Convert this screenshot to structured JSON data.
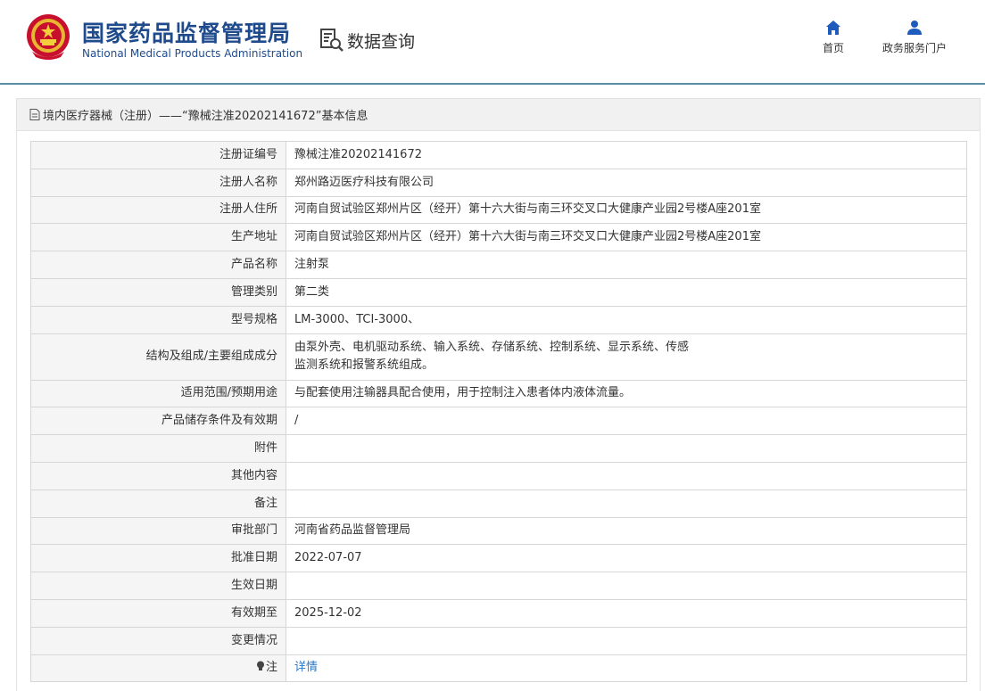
{
  "header": {
    "logo_cn": "国家药品监督管理局",
    "logo_en": "National Medical Products Administration",
    "query_label": "数据查询",
    "nav": [
      {
        "label": "首页",
        "icon": "home-icon"
      },
      {
        "label": "政务服务门户",
        "icon": "user-icon"
      }
    ],
    "accent_color": "#1f4a8c"
  },
  "panel": {
    "title": "境内医疗器械（注册）——“豫械注准20202141672”基本信息"
  },
  "rows": [
    {
      "key": "注册证编号",
      "value": "豫械注准20202141672"
    },
    {
      "key": "注册人名称",
      "value": "郑州路迈医疗科技有限公司"
    },
    {
      "key": "注册人住所",
      "value": "河南自贸试验区郑州片区（经开）第十六大街与南三环交叉口大健康产业园2号楼A座201室"
    },
    {
      "key": "生产地址",
      "value": "河南自贸试验区郑州片区（经开）第十六大街与南三环交叉口大健康产业园2号楼A座201室"
    },
    {
      "key": "产品名称",
      "value": "注射泵"
    },
    {
      "key": "管理类别",
      "value": "第二类"
    },
    {
      "key": "型号规格",
      "value": "LM-3000、TCI-3000、"
    },
    {
      "key": "结构及组成/主要组成成分",
      "value_line1": "由泵外壳、电机驱动系统、输入系统、存储系统、控制系统、显示系统、传感",
      "value_line2": "监测系统和报警系统组成。"
    },
    {
      "key": "适用范围/预期用途",
      "value": "与配套使用注输器具配合使用，用于控制注入患者体内液体流量。"
    },
    {
      "key": "产品储存条件及有效期",
      "value": "/"
    },
    {
      "key": "附件",
      "value": ""
    },
    {
      "key": "其他内容",
      "value": ""
    },
    {
      "key": "备注",
      "value": ""
    },
    {
      "key": "审批部门",
      "value": "河南省药品监督管理局"
    },
    {
      "key": "批准日期",
      "value": "2022-07-07"
    },
    {
      "key": "生效日期",
      "value": ""
    },
    {
      "key": "有效期至",
      "value": "2025-12-02"
    },
    {
      "key": "变更情况",
      "value": ""
    },
    {
      "key": "注",
      "value": "详情",
      "icon": "lightbulb-icon"
    }
  ]
}
